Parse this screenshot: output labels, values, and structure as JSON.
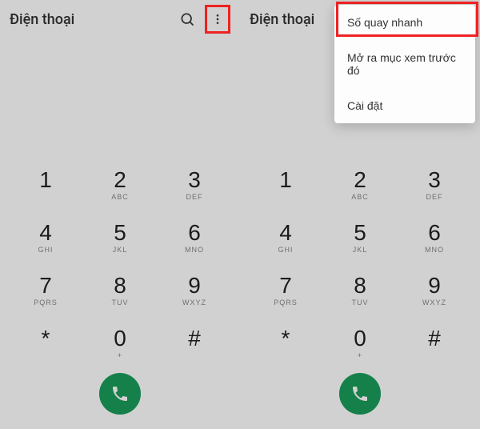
{
  "left": {
    "title": "Điện thoại",
    "keys": [
      [
        {
          "d": "1",
          "s": ""
        },
        {
          "d": "2",
          "s": "ABC"
        },
        {
          "d": "3",
          "s": "DEF"
        }
      ],
      [
        {
          "d": "4",
          "s": "GHI"
        },
        {
          "d": "5",
          "s": "JKL"
        },
        {
          "d": "6",
          "s": "MNO"
        }
      ],
      [
        {
          "d": "7",
          "s": "PQRS"
        },
        {
          "d": "8",
          "s": "TUV"
        },
        {
          "d": "9",
          "s": "WXYZ"
        }
      ],
      [
        {
          "d": "*",
          "s": ""
        },
        {
          "d": "0",
          "s": "+"
        },
        {
          "d": "#",
          "s": ""
        }
      ]
    ]
  },
  "right": {
    "title": "Điện thoại",
    "menu": {
      "item1": "Số quay nhanh",
      "item2": "Mở ra mục xem trước đó",
      "item3": "Cài đặt"
    },
    "keys": [
      [
        {
          "d": "1",
          "s": ""
        },
        {
          "d": "2",
          "s": "ABC"
        },
        {
          "d": "3",
          "s": "DEF"
        }
      ],
      [
        {
          "d": "4",
          "s": "GHI"
        },
        {
          "d": "5",
          "s": "JKL"
        },
        {
          "d": "6",
          "s": "MNO"
        }
      ],
      [
        {
          "d": "7",
          "s": "PQRS"
        },
        {
          "d": "8",
          "s": "TUV"
        },
        {
          "d": "9",
          "s": "WXYZ"
        }
      ],
      [
        {
          "d": "*",
          "s": ""
        },
        {
          "d": "0",
          "s": "+"
        },
        {
          "d": "#",
          "s": ""
        }
      ]
    ]
  },
  "colors": {
    "call_green": "#1a9d5a",
    "highlight_red": "#e22"
  }
}
